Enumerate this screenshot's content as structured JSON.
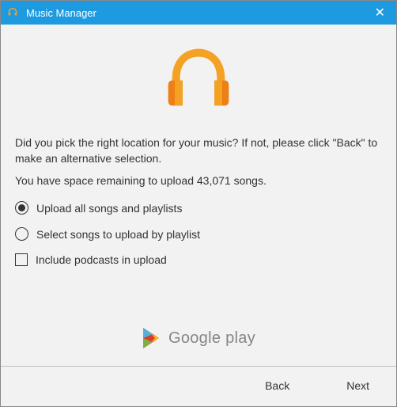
{
  "window": {
    "title": "Music Manager"
  },
  "main": {
    "prompt": "Did you pick the right location for your music? If not, please click \"Back\" to make an alternative selection.",
    "space_text": "You have space remaining to upload 43,071 songs.",
    "options": {
      "upload_all": {
        "label": "Upload all songs and playlists",
        "selected": true
      },
      "by_playlist": {
        "label": "Select songs to upload by playlist",
        "selected": false
      }
    },
    "podcasts": {
      "label": "Include podcasts in upload",
      "checked": false
    }
  },
  "branding": {
    "google": "Google",
    "play": " play"
  },
  "footer": {
    "back": "Back",
    "next": "Next"
  },
  "colors": {
    "titlebar": "#1e9ae0",
    "headphones_primary": "#f4a223",
    "headphones_shadow": "#ed7f16"
  }
}
